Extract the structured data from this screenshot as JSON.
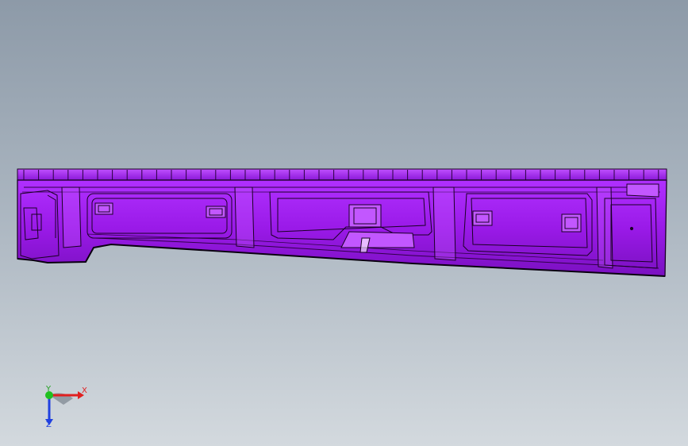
{
  "viewport": {
    "background_top": "#8d9aa8",
    "background_bottom": "#d3d9de"
  },
  "model": {
    "name_icon": "sheet-metal-panel",
    "body_color": "#a020f0",
    "edge_color": "#1a0024",
    "highlight_color": "#d37bff"
  },
  "triad": {
    "x_label": "X",
    "y_label": "Y",
    "z_label": "Z",
    "x_color": "#e02020",
    "y_color": "#20c020",
    "z_color": "#2040e0"
  }
}
